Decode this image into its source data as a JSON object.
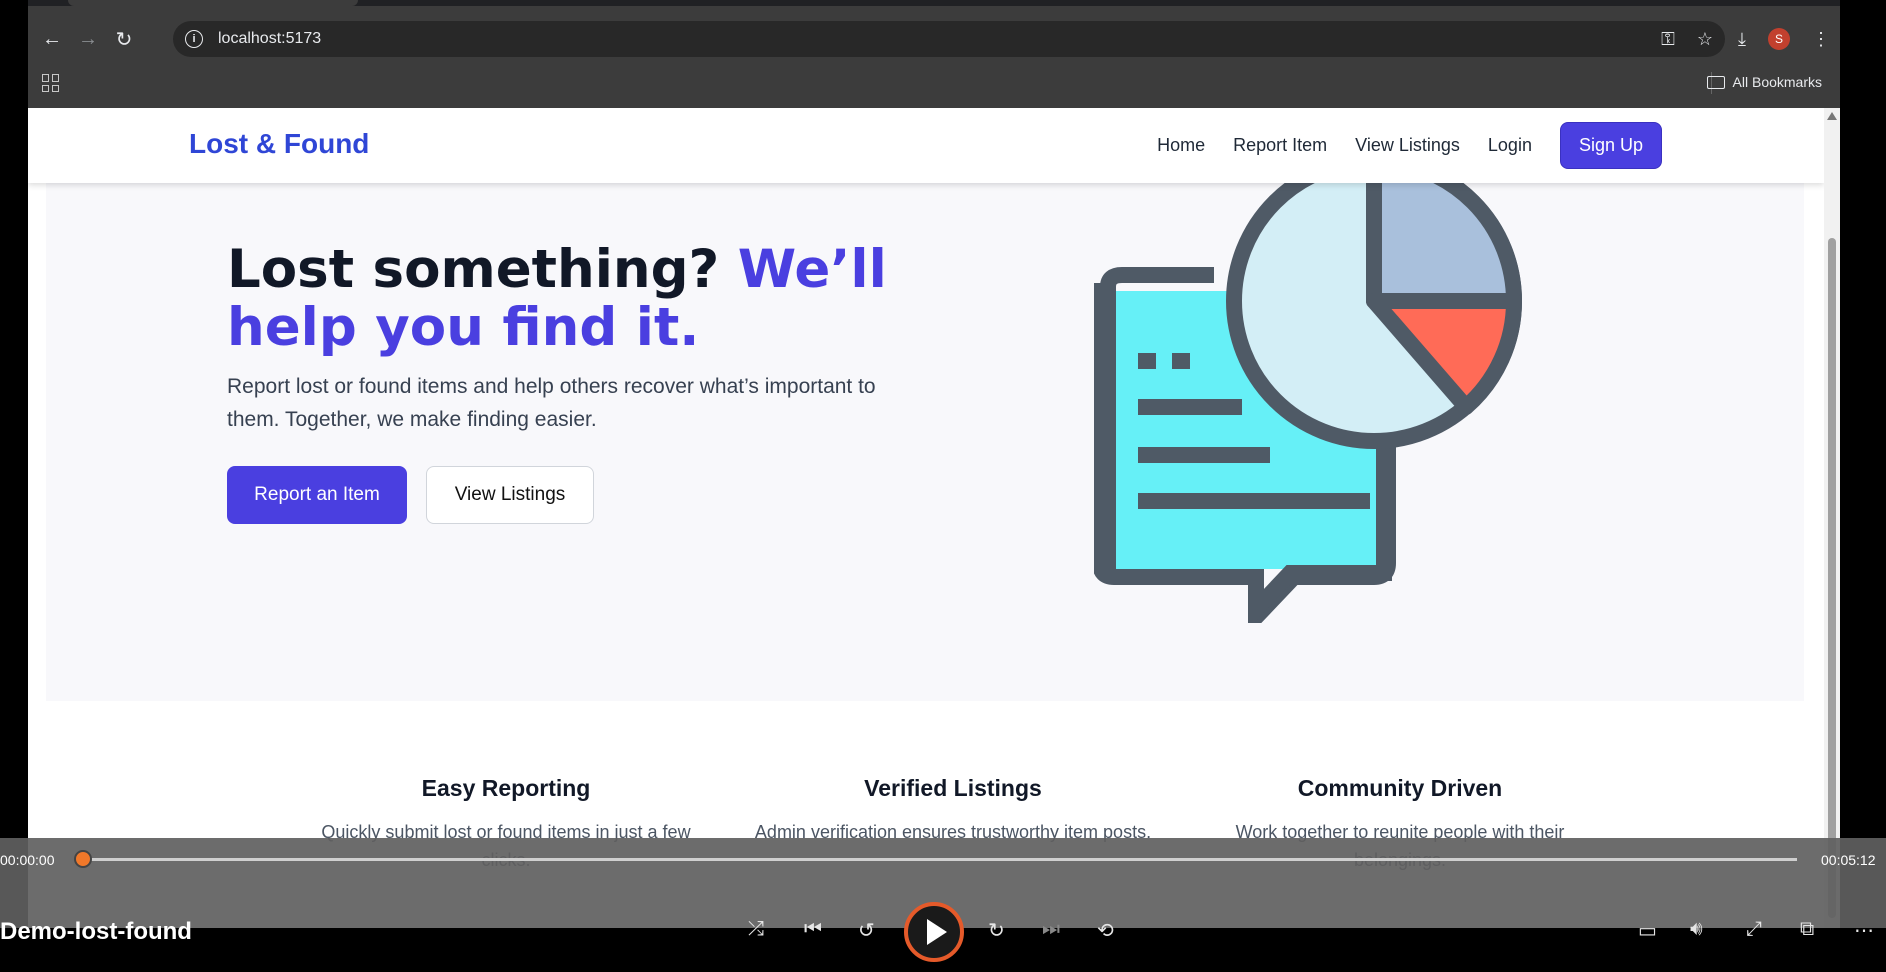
{
  "browser": {
    "url": "localhost:5173",
    "bookmarks_label": "All Bookmarks",
    "profile_initial": "S"
  },
  "site": {
    "brand": "Lost & Found",
    "nav": [
      "Home",
      "Report Item",
      "View Listings",
      "Login"
    ],
    "signup_label": "Sign Up"
  },
  "hero": {
    "headline_plain": "Lost something? ",
    "headline_accent": "We’ll help you find it.",
    "subtext": "Report lost or found items and help others recover what’s important to them. Together, we make finding easier.",
    "primary_button": "Report an Item",
    "secondary_button": "View Listings"
  },
  "features": [
    {
      "title": "Easy Reporting",
      "text": "Quickly submit lost or found items in just a few clicks."
    },
    {
      "title": "Verified Listings",
      "text": "Admin verification ensures trustworthy item posts."
    },
    {
      "title": "Community Driven",
      "text": "Work together to reunite people with their belongings."
    }
  ],
  "player": {
    "title": "Demo-lost-found",
    "time_current": "00:00:00",
    "time_total": "00:05:12",
    "progress": 0,
    "accent": "#f0782a"
  },
  "colors": {
    "brand": "#2f46d6",
    "primary": "#4a3fe0"
  }
}
